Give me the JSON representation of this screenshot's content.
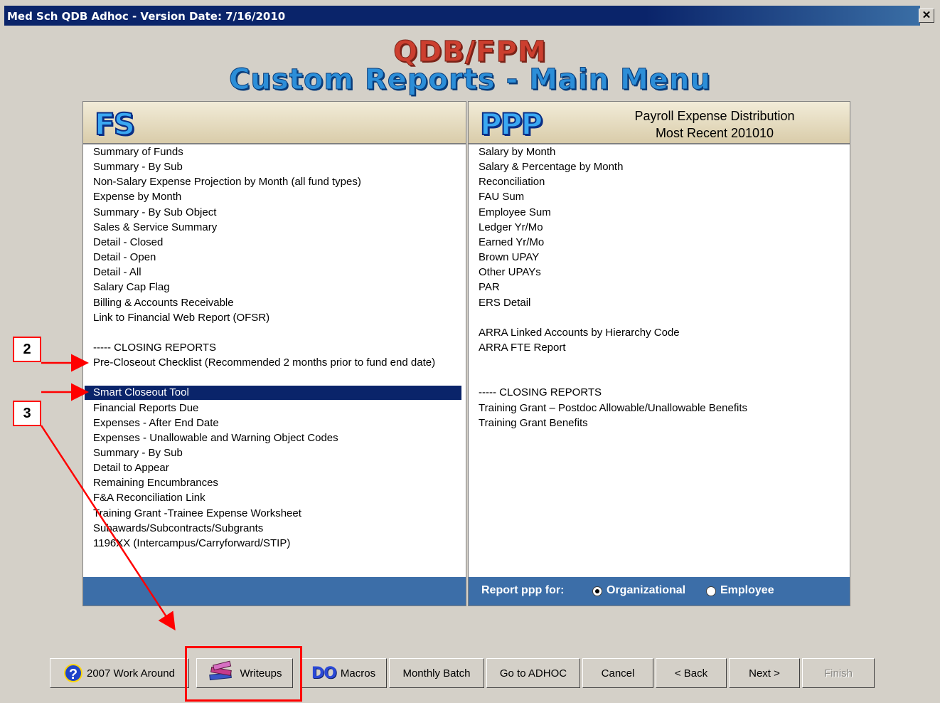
{
  "window": {
    "title": "Med Sch QDB Adhoc - Version Date: 7/16/2010",
    "close_glyph": "✕"
  },
  "header": {
    "line1": "QDB/FPM",
    "line2": "Custom Reports - Main Menu"
  },
  "fs_panel": {
    "logo": "FS",
    "items": [
      "Summary of Funds",
      "Summary - By Sub",
      "Non-Salary Expense Projection by Month (all fund types)",
      "Expense by Month",
      "Summary - By Sub Object",
      "Sales & Service Summary",
      "Detail - Closed",
      "Detail - Open",
      "Detail - All",
      "Salary Cap Flag",
      "Billing & Accounts Receivable",
      "Link to Financial Web Report (OFSR)",
      "",
      "----- CLOSING REPORTS",
      "Pre-Closeout Checklist (Recommended 2 months prior to fund end date)",
      "",
      "Smart Closeout Tool",
      "Financial Reports Due",
      "Expenses - After End Date",
      "Expenses - Unallowable and Warning Object Codes",
      "Summary - By Sub",
      "Detail to Appear",
      "Remaining Encumbrances",
      "F&A Reconciliation Link",
      "Training Grant -Trainee Expense Worksheet",
      "Subawards/Subcontracts/Subgrants",
      "1196XX (Intercampus/Carryforward/STIP)"
    ],
    "selected_index": 16
  },
  "ppp_panel": {
    "logo": "PPP",
    "subtitle_line1": "Payroll Expense Distribution",
    "subtitle_line2": "Most Recent 201010",
    "items": [
      "Salary by Month",
      "Salary & Percentage by Month",
      "Reconciliation",
      "FAU Sum",
      "Employee Sum",
      "Ledger Yr/Mo",
      "Earned Yr/Mo",
      "Brown UPAY",
      "Other UPAYs",
      "PAR",
      "ERS Detail",
      "",
      "ARRA Linked Accounts by Hierarchy Code",
      "ARRA FTE Report",
      "",
      "",
      "----- CLOSING REPORTS",
      "Training Grant – Postdoc Allowable/Unallowable Benefits",
      "Training Grant Benefits"
    ],
    "footer_label": "Report  ppp for:",
    "radio_org": "Organizational",
    "radio_emp": "Employee",
    "radio_selected": "Organizational"
  },
  "buttons": {
    "work_around": "2007 Work Around",
    "writeups": "Writeups",
    "macros_icon": "DO",
    "macros": "Macros",
    "monthly_batch": "Monthly Batch",
    "go_to_adhoc": "Go to ADHOC",
    "cancel": "Cancel",
    "back": "< Back",
    "next": "Next >",
    "finish": "Finish"
  },
  "callouts": {
    "c2": "2",
    "c3": "3"
  },
  "colors": {
    "annotation": "#ff0000",
    "selection": "#0a246a",
    "footer": "#3c6ea8"
  }
}
